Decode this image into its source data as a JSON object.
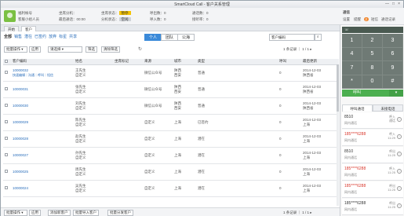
{
  "window": {
    "title": "SmartCloud Call - 客户关系管理",
    "controls": [
      "—",
      "□",
      "×"
    ]
  },
  "header": {
    "user": "福利帐号",
    "team": "客服小组人员",
    "fields": [
      {
        "label": "坐席分机：",
        "value": ""
      },
      {
        "label": "坐席状态：",
        "value": "暂停"
      },
      {
        "label": "呼出数：",
        "value": "0"
      },
      {
        "label": "通话数：",
        "value": "0"
      },
      {
        "label": "最后通话：",
        "value": "00:00"
      },
      {
        "label": "分机状态：",
        "value": "空闲"
      },
      {
        "label": "呼入数：",
        "value": "0"
      },
      {
        "label": "接听率：",
        "value": "0"
      }
    ],
    "right": {
      "title": "通信",
      "items": [
        "设置",
        "提醒",
        "短信",
        "通话记录"
      ],
      "badge": "2"
    }
  },
  "tabs": [
    "开始",
    "客户"
  ],
  "filters": [
    "全部",
    "销售",
    "潜在",
    "已签约",
    "放弃",
    "标星",
    "共享"
  ],
  "view_toggle": [
    "个人",
    "团队",
    "公海"
  ],
  "search": {
    "placeholder": "客户编码"
  },
  "toolbar": {
    "batch": "批量操作",
    "apply": "应用",
    "select": "请选择",
    "filter": "筛选",
    "clear": "清除筛选"
  },
  "pager": "1 条记录 ｜ 1 / 1 ▸",
  "table": {
    "headers": [
      "",
      "客户编码",
      "姓名",
      "坐席标记",
      "来源",
      "城市",
      "类型",
      "",
      "呼叫",
      "最后更新"
    ],
    "rows": [
      {
        "code": "10000032",
        "sub": "快速编辑｜沟通｜呼叫｜短信",
        "name": "王先生",
        "name2": "自定义",
        "tag": "",
        "source": "微信公众号",
        "city": "陕西",
        "city2": "西安",
        "type": "普通",
        "calls": "0",
        "upd": "2014-12-03",
        "upd2": "陕西省"
      },
      {
        "code": "10000031",
        "sub": "",
        "name": "张先生",
        "name2": "自定义",
        "tag": "",
        "source": "微信公众号",
        "city": "陕西",
        "city2": "西安",
        "type": "普通",
        "calls": "0",
        "upd": "2014-12-03",
        "upd2": "陕西省"
      },
      {
        "code": "10000030",
        "sub": "",
        "name": "刘先生",
        "name2": "自定义",
        "tag": "",
        "source": "微信公众号",
        "city": "陕西",
        "city2": "西安",
        "type": "普通",
        "calls": "0",
        "upd": "2014-12-03",
        "upd2": "陕西省"
      },
      {
        "code": "10000029",
        "sub": "",
        "name": "陈先生",
        "name2": "自定义",
        "tag": "",
        "source": "自定义",
        "city": "上海",
        "city2": "",
        "type": "已签约",
        "calls": "0",
        "upd": "2014-12-03",
        "upd2": "上海"
      },
      {
        "code": "10000028",
        "sub": "",
        "name": "赵先生",
        "name2": "自定义",
        "tag": "",
        "source": "自定义",
        "city": "上海",
        "city2": "",
        "type": "潜在",
        "calls": "0",
        "upd": "2014-12-03",
        "upd2": "上海"
      },
      {
        "code": "10000027",
        "sub": "",
        "name": "孙先生",
        "name2": "自定义",
        "tag": "",
        "source": "自定义",
        "city": "上海",
        "city2": "",
        "type": "潜在",
        "calls": "0",
        "upd": "2014-12-03",
        "upd2": "上海"
      },
      {
        "code": "10000025",
        "sub": "",
        "name": "周先生",
        "name2": "自定义",
        "tag": "",
        "source": "自定义",
        "city": "上海",
        "city2": "",
        "type": "潜在",
        "calls": "0",
        "upd": "2014-12-03",
        "upd2": "上海"
      },
      {
        "code": "10000024",
        "sub": "",
        "name": "吴先生",
        "name2": "自定义",
        "tag": "",
        "source": "自定义",
        "city": "上海",
        "city2": "",
        "type": "潜在",
        "calls": "0",
        "upd": "2014-12-03",
        "upd2": "上海"
      }
    ]
  },
  "bottombar": {
    "batch": "批量操作",
    "apply": "应用",
    "add": "添加新客户",
    "import": "批量导入客户",
    "assign": "批量分发客户",
    "pager": "1 条记录 ｜ 1 / 1 ▸"
  },
  "phone": {
    "input": "",
    "keys": [
      "1",
      "2",
      "3",
      "4",
      "5",
      "6",
      "7",
      "8",
      "9",
      "*",
      "0",
      "#"
    ],
    "call": "呼叫",
    "menu": "▾",
    "hist_tabs": [
      "呼叫通话",
      "未接电话"
    ],
    "history": [
      {
        "num": "8510",
        "desc": "网内通话",
        "st": "呼入",
        "st2": "通话",
        "red": false
      },
      {
        "num": "185****6288",
        "desc": "网内通话",
        "st": "呼入",
        "st2": "11:29",
        "red": true
      },
      {
        "num": "8510",
        "desc": "网内通话",
        "st": "呼出",
        "st2": "11:25",
        "red": false
      },
      {
        "num": "185****6288",
        "desc": "网内通话",
        "st": "呼入",
        "st2": "11:25",
        "red": true
      },
      {
        "num": "185****6288",
        "desc": "网内通话",
        "st": "呼出",
        "st2": "11:25",
        "red": true
      },
      {
        "num": "185****6288",
        "desc": "网内通话",
        "st": "呼出",
        "st2": "11:25",
        "red": false
      }
    ]
  }
}
